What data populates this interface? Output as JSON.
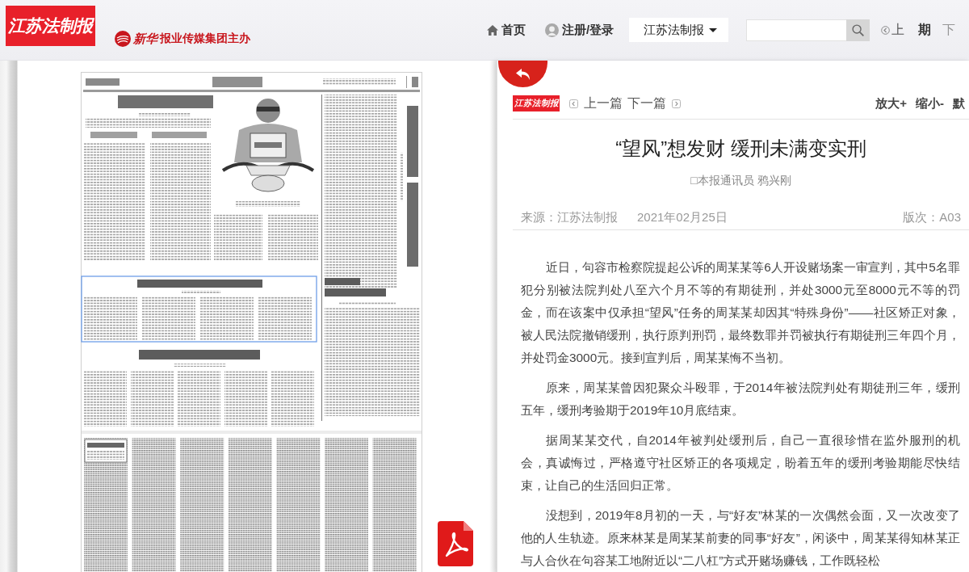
{
  "header": {
    "logo": "江苏法制报",
    "publisher": {
      "brand": "新华",
      "text": "报业传媒集团主办"
    },
    "nav": [
      {
        "kind": "home",
        "label": "首页"
      },
      {
        "kind": "user",
        "label": "注册/登录"
      }
    ],
    "paper_select": {
      "value": "江苏法制报"
    },
    "issue_nav": {
      "prev": {
        "label": "上",
        "disabled": false
      },
      "current": "期",
      "next": {
        "label": "下",
        "disabled": true
      }
    }
  },
  "article": {
    "masthead": "江苏法制报",
    "pager": [
      {
        "kind": "prev",
        "label": "上一篇"
      },
      {
        "kind": "next",
        "label": "下一篇"
      }
    ],
    "font_controls": [
      "放大+",
      "缩小-",
      "默"
    ],
    "title": "“望风”想发财 缓刑未满变实刑",
    "byline": "□本报通讯员 鸦兴刚",
    "meta": {
      "source": "来源：江苏法制报",
      "date": "2021年02月25日",
      "edition": "版次：A03"
    },
    "paragraphs": [
      "近日，句容市检察院提起公诉的周某某等6人开设赌场案一审宣判，其中5名罪犯分别被法院判处八至六个月不等的有期徒刑，并处3000元至8000元不等的罚金，而在该案中仅承担“望风”任务的周某某却因其“特殊身份”——社区矫正对象，被人民法院撤销缓刑，执行原判刑罚，最终数罪并罚被执行有期徒刑三年四个月，并处罚金3000元。接到宣判后，周某某悔不当初。",
      "原来，周某某曾因犯聚众斗殴罪，于2014年被法院判处有期徒刑三年，缓刑五年，缓刑考验期于2019年10月底结束。",
      "据周某某交代，自2014年被判处缓刑后，自己一直很珍惜在监外服刑的机会，真诚悔过，严格遵守社区矫正的各项规定，盼着五年的缓刑考验期能尽快结束，让自己的生活回归正常。",
      "没想到，2019年8月初的一天，与“好友”林某的一次偶然会面，又一次改变了他的人生轨迹。原来林某是周某某前妻的同事“好友”，闲谈中，周某某得知林某正与人合伙在句容某工地附近以“二八杠”方式开赌场赚钱，工作既轻松"
    ]
  }
}
